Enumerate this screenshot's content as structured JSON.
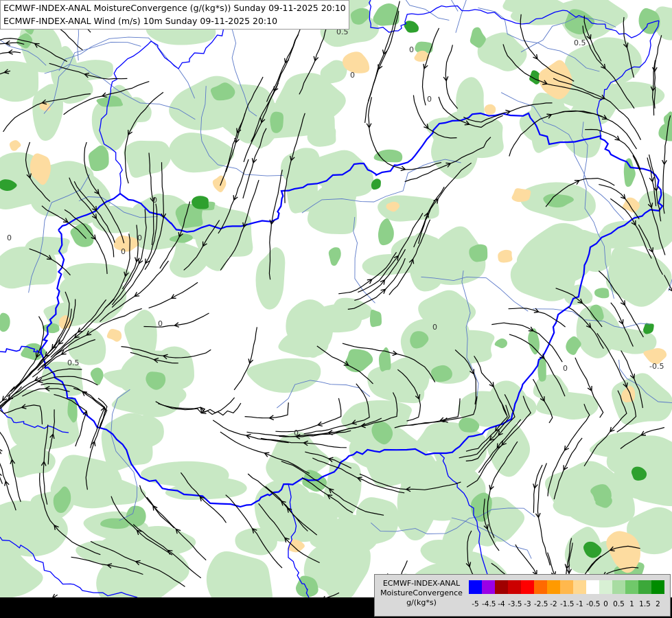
{
  "header": {
    "line1": "ECMWF-INDEX-ANAL MoistureConvergence (g/(kg*s)) Sunday 09-11-2025 20:10",
    "line2": "ECMWF-INDEX-ANAL Wind (m/s) 10m Sunday 09-11-2025 20:10"
  },
  "map": {
    "contour_labels": [
      "0.5",
      "0.5",
      "0.5",
      "0",
      "0",
      "0",
      "0",
      "0",
      "0",
      "-0.5",
      "0",
      "0",
      "0",
      "0",
      "0"
    ],
    "colors": {
      "background": "#ffffff",
      "light_green": "#c8e8c4",
      "mid_green": "#8ed08a",
      "dark_green": "#2ea02e",
      "light_orange": "#fddca0",
      "country_border": "#0000ff",
      "rivers": "#5a78c8",
      "streamlines": "#000000"
    }
  },
  "legend": {
    "title_lines": [
      "ECMWF-INDEX-ANAL",
      "MoistureConvergence",
      "g/(kg*s)"
    ],
    "colors": [
      "#0000ff",
      "#9a00e6",
      "#a00000",
      "#cc0000",
      "#ff0000",
      "#ff6a00",
      "#ff9a00",
      "#ffb84d",
      "#ffd890",
      "#ffffff",
      "#d8f0d4",
      "#a8dca2",
      "#70c86a",
      "#3ca83a",
      "#008c00"
    ],
    "ticks": [
      "-5",
      "-4.5",
      "-4",
      "-3.5",
      "-3",
      "-2.5",
      "-2",
      "-1.5",
      "-1",
      "-0.5",
      "0",
      "0.5",
      "1",
      "1.5",
      "2"
    ]
  }
}
